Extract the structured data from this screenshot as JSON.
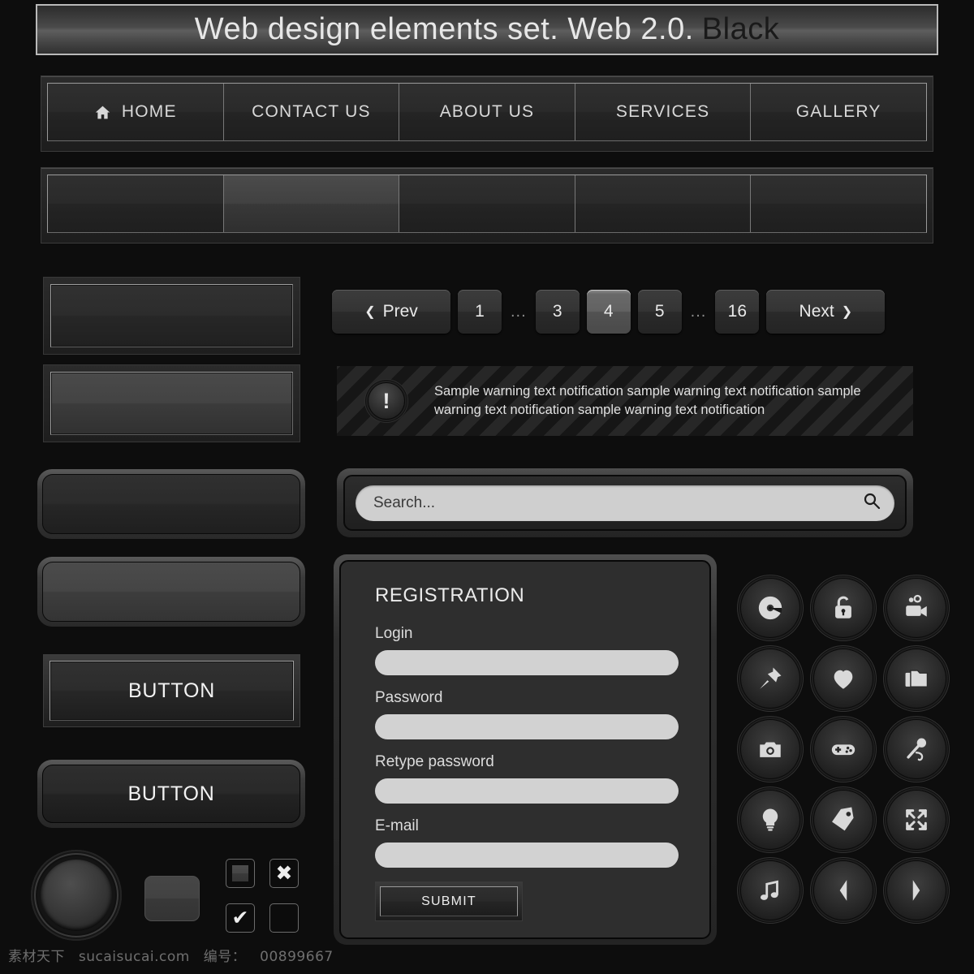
{
  "title": {
    "main": "Web design elements set. Web 2.0.",
    "accent": "Black"
  },
  "nav": {
    "items": [
      {
        "label": "HOME",
        "icon": "home-icon"
      },
      {
        "label": "CONTACT US",
        "icon": ""
      },
      {
        "label": "ABOUT US",
        "icon": ""
      },
      {
        "label": "SERVICES",
        "icon": ""
      },
      {
        "label": "GALLERY",
        "icon": ""
      }
    ],
    "empty_cells": [
      "",
      "",
      "",
      "",
      ""
    ]
  },
  "pagination": {
    "prev_label": "Prev",
    "next_label": "Next",
    "prev_arrow": "❮",
    "next_arrow": "❯",
    "ellipsis": "...",
    "pages": [
      "1",
      "3",
      "4",
      "5",
      "16"
    ],
    "active_page": "4"
  },
  "warning": {
    "icon": "exclamation-icon",
    "glyph": "!",
    "text": "Sample warning text notification sample warning text notification sample warning text notification sample warning text notification"
  },
  "search": {
    "placeholder": "Search...",
    "value": "",
    "icon": "search-icon"
  },
  "registration": {
    "title": "REGISTRATION",
    "fields": [
      {
        "label": "Login",
        "value": ""
      },
      {
        "label": "Password",
        "value": ""
      },
      {
        "label": "Retype password",
        "value": ""
      },
      {
        "label": "E-mail",
        "value": ""
      }
    ],
    "submit_label": "SUBMIT"
  },
  "buttons": {
    "square_label": "BUTTON",
    "round_label": "BUTTON",
    "blank_label": ""
  },
  "checkboxes": [
    {
      "name": "checkbox-filled",
      "state": "filled"
    },
    {
      "name": "checkbox-cross",
      "state": "cross",
      "glyph": "✖"
    },
    {
      "name": "checkbox-check",
      "state": "checked",
      "glyph": "✔"
    },
    {
      "name": "checkbox-empty",
      "state": "empty",
      "glyph": ""
    }
  ],
  "icon_grid": [
    "disc-icon",
    "lock-icon",
    "video-camera-icon",
    "pushpin-icon",
    "heart-icon",
    "folder-icon",
    "camera-icon",
    "gamepad-icon",
    "microphone-icon",
    "lightbulb-icon",
    "tag-icon",
    "fullscreen-icon",
    "music-note-icon",
    "arrow-left-icon",
    "arrow-right-icon"
  ],
  "watermark": {
    "site_cn": "素材天下",
    "site": "sucaisucai.com",
    "id_label": "编号：",
    "id_value": "00899667"
  },
  "colors": {
    "background": "#0d0d0d",
    "panel": "#2e2e2e",
    "text": "#e7e7e7",
    "accent_dark": "#1a1a1a",
    "input_light": "#d2d2d2",
    "active_page": "#626262"
  }
}
